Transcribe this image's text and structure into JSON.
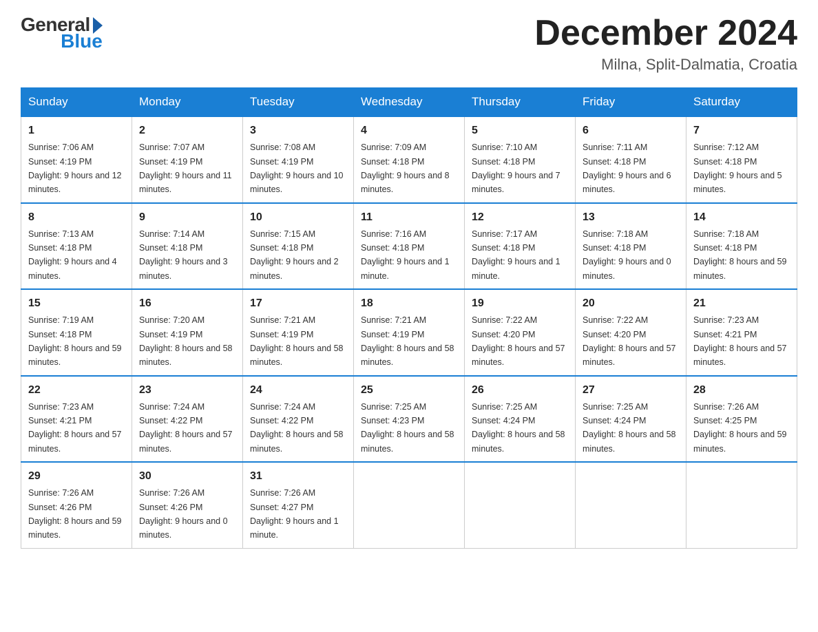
{
  "header": {
    "logo_general": "General",
    "logo_blue": "Blue",
    "month_title": "December 2024",
    "location": "Milna, Split-Dalmatia, Croatia"
  },
  "weekdays": [
    "Sunday",
    "Monday",
    "Tuesday",
    "Wednesday",
    "Thursday",
    "Friday",
    "Saturday"
  ],
  "weeks": [
    [
      {
        "day": "1",
        "sunrise": "7:06 AM",
        "sunset": "4:19 PM",
        "daylight": "9 hours and 12 minutes."
      },
      {
        "day": "2",
        "sunrise": "7:07 AM",
        "sunset": "4:19 PM",
        "daylight": "9 hours and 11 minutes."
      },
      {
        "day": "3",
        "sunrise": "7:08 AM",
        "sunset": "4:19 PM",
        "daylight": "9 hours and 10 minutes."
      },
      {
        "day": "4",
        "sunrise": "7:09 AM",
        "sunset": "4:18 PM",
        "daylight": "9 hours and 8 minutes."
      },
      {
        "day": "5",
        "sunrise": "7:10 AM",
        "sunset": "4:18 PM",
        "daylight": "9 hours and 7 minutes."
      },
      {
        "day": "6",
        "sunrise": "7:11 AM",
        "sunset": "4:18 PM",
        "daylight": "9 hours and 6 minutes."
      },
      {
        "day": "7",
        "sunrise": "7:12 AM",
        "sunset": "4:18 PM",
        "daylight": "9 hours and 5 minutes."
      }
    ],
    [
      {
        "day": "8",
        "sunrise": "7:13 AM",
        "sunset": "4:18 PM",
        "daylight": "9 hours and 4 minutes."
      },
      {
        "day": "9",
        "sunrise": "7:14 AM",
        "sunset": "4:18 PM",
        "daylight": "9 hours and 3 minutes."
      },
      {
        "day": "10",
        "sunrise": "7:15 AM",
        "sunset": "4:18 PM",
        "daylight": "9 hours and 2 minutes."
      },
      {
        "day": "11",
        "sunrise": "7:16 AM",
        "sunset": "4:18 PM",
        "daylight": "9 hours and 1 minute."
      },
      {
        "day": "12",
        "sunrise": "7:17 AM",
        "sunset": "4:18 PM",
        "daylight": "9 hours and 1 minute."
      },
      {
        "day": "13",
        "sunrise": "7:18 AM",
        "sunset": "4:18 PM",
        "daylight": "9 hours and 0 minutes."
      },
      {
        "day": "14",
        "sunrise": "7:18 AM",
        "sunset": "4:18 PM",
        "daylight": "8 hours and 59 minutes."
      }
    ],
    [
      {
        "day": "15",
        "sunrise": "7:19 AM",
        "sunset": "4:18 PM",
        "daylight": "8 hours and 59 minutes."
      },
      {
        "day": "16",
        "sunrise": "7:20 AM",
        "sunset": "4:19 PM",
        "daylight": "8 hours and 58 minutes."
      },
      {
        "day": "17",
        "sunrise": "7:21 AM",
        "sunset": "4:19 PM",
        "daylight": "8 hours and 58 minutes."
      },
      {
        "day": "18",
        "sunrise": "7:21 AM",
        "sunset": "4:19 PM",
        "daylight": "8 hours and 58 minutes."
      },
      {
        "day": "19",
        "sunrise": "7:22 AM",
        "sunset": "4:20 PM",
        "daylight": "8 hours and 57 minutes."
      },
      {
        "day": "20",
        "sunrise": "7:22 AM",
        "sunset": "4:20 PM",
        "daylight": "8 hours and 57 minutes."
      },
      {
        "day": "21",
        "sunrise": "7:23 AM",
        "sunset": "4:21 PM",
        "daylight": "8 hours and 57 minutes."
      }
    ],
    [
      {
        "day": "22",
        "sunrise": "7:23 AM",
        "sunset": "4:21 PM",
        "daylight": "8 hours and 57 minutes."
      },
      {
        "day": "23",
        "sunrise": "7:24 AM",
        "sunset": "4:22 PM",
        "daylight": "8 hours and 57 minutes."
      },
      {
        "day": "24",
        "sunrise": "7:24 AM",
        "sunset": "4:22 PM",
        "daylight": "8 hours and 58 minutes."
      },
      {
        "day": "25",
        "sunrise": "7:25 AM",
        "sunset": "4:23 PM",
        "daylight": "8 hours and 58 minutes."
      },
      {
        "day": "26",
        "sunrise": "7:25 AM",
        "sunset": "4:24 PM",
        "daylight": "8 hours and 58 minutes."
      },
      {
        "day": "27",
        "sunrise": "7:25 AM",
        "sunset": "4:24 PM",
        "daylight": "8 hours and 58 minutes."
      },
      {
        "day": "28",
        "sunrise": "7:26 AM",
        "sunset": "4:25 PM",
        "daylight": "8 hours and 59 minutes."
      }
    ],
    [
      {
        "day": "29",
        "sunrise": "7:26 AM",
        "sunset": "4:26 PM",
        "daylight": "8 hours and 59 minutes."
      },
      {
        "day": "30",
        "sunrise": "7:26 AM",
        "sunset": "4:26 PM",
        "daylight": "9 hours and 0 minutes."
      },
      {
        "day": "31",
        "sunrise": "7:26 AM",
        "sunset": "4:27 PM",
        "daylight": "9 hours and 1 minute."
      },
      null,
      null,
      null,
      null
    ]
  ],
  "labels": {
    "sunrise": "Sunrise:",
    "sunset": "Sunset:",
    "daylight": "Daylight:"
  }
}
